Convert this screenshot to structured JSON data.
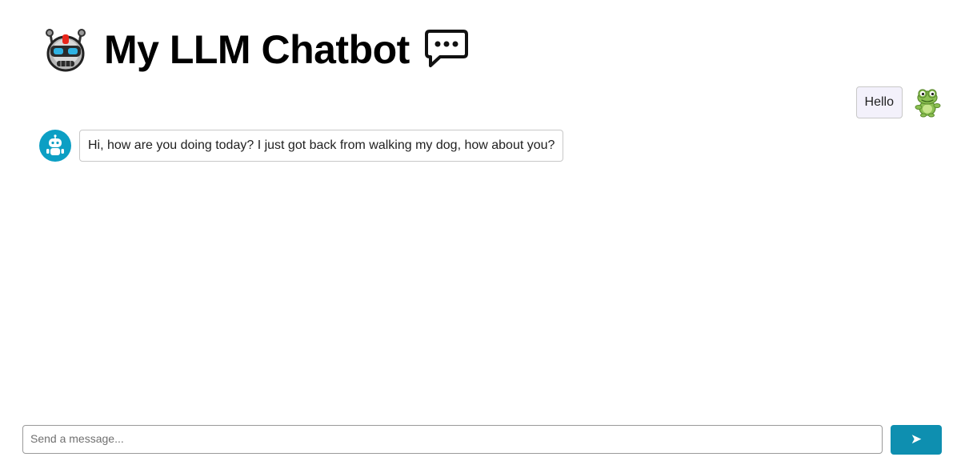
{
  "header": {
    "title": "My LLM Chatbot",
    "left_icon": "robot-face-icon",
    "right_icon": "speech-bubble-icon"
  },
  "messages": [
    {
      "role": "user",
      "text": "Hello",
      "avatar": "frog-avatar-icon"
    },
    {
      "role": "bot",
      "text": "Hi, how are you doing today? I just got back from walking my dog, how about you?",
      "avatar": "robot-avatar-icon"
    }
  ],
  "composer": {
    "placeholder": "Send a message...",
    "value": "",
    "send_label": "➤"
  },
  "colors": {
    "accent": "#0e8fb0",
    "bot_avatar_bg": "#0c9fc4",
    "user_bubble_bg": "#f3f1fb",
    "bubble_border": "#c8c8c8"
  }
}
